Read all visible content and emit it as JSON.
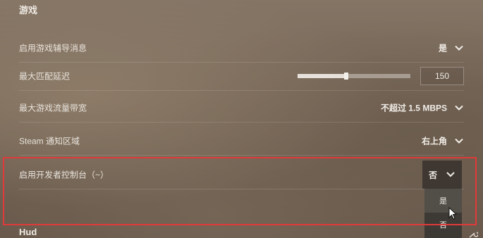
{
  "section_title": "游戏",
  "settings": [
    {
      "label": "启用游戏辅导消息",
      "value": "是"
    },
    {
      "label": "最大匹配延迟",
      "slider_value": "150",
      "slider_fraction": 0.43
    },
    {
      "label": "最大游戏流量带宽",
      "value": "不超过 1.5 MBPS"
    },
    {
      "label": "Steam 通知区域",
      "value": "右上角"
    },
    {
      "label": "启用开发者控制台（~）",
      "value": "否"
    }
  ],
  "dropdown_options": [
    "是",
    "否"
  ],
  "next_section_title": "Hud",
  "colors": {
    "highlight_border": "#e03a3a"
  },
  "icons": {
    "chevron": "chevron-down-icon",
    "cursor": "mouse-cursor-icon"
  }
}
